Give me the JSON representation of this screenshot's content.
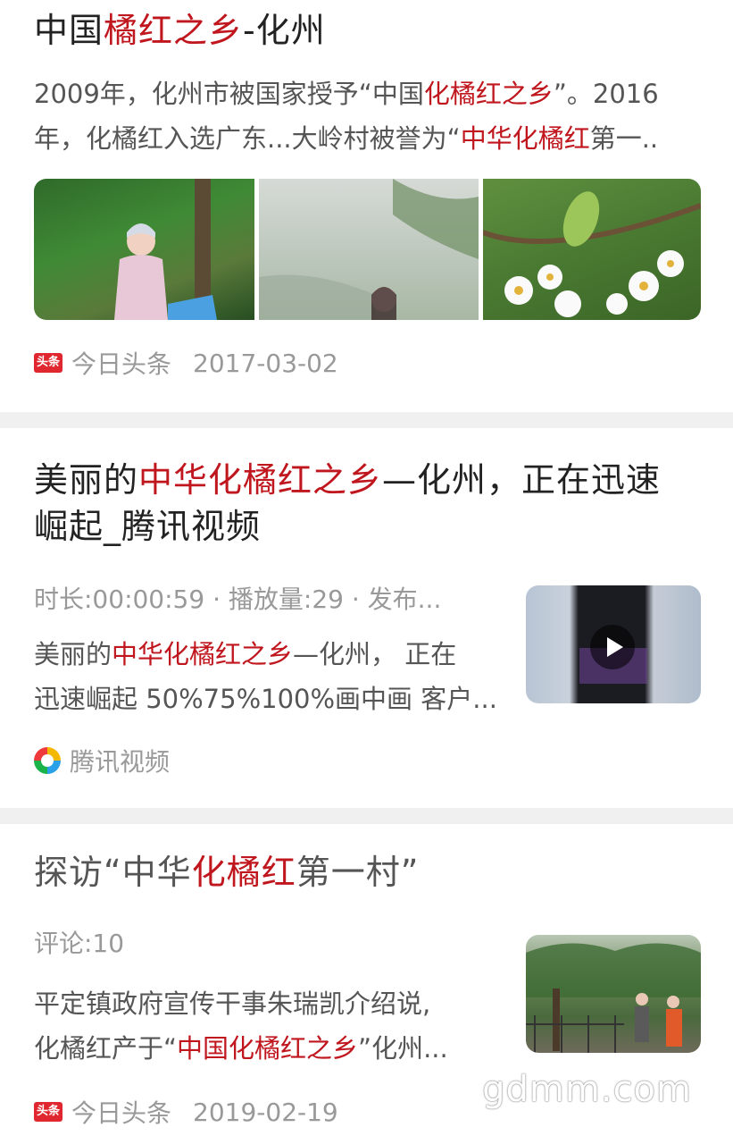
{
  "results": [
    {
      "title_parts": [
        "中国",
        "橘红之乡",
        "-化州"
      ],
      "snippet_line1_parts": [
        "2009年，化州市被国家授予“中国",
        "化橘红之乡",
        "”。2016"
      ],
      "snippet_line2_parts": [
        "年，化橘红入选广东...大岭村被誉为“",
        "中华化橘红",
        "第一.."
      ],
      "source": "今日头条",
      "date": "2017-03-02"
    },
    {
      "title_line1_parts": [
        "美丽的",
        "中华化橘红之乡",
        "—化州，正在迅速"
      ],
      "title_line2": "崛起_腾讯视频",
      "meta": "时长:00:00:59 · 播放量:29 · 发布...",
      "snippet_line1_parts": [
        "美丽的",
        "中华化橘红之乡",
        "—化州， 正在"
      ],
      "snippet_line2": "迅速崛起 50%75%100%画中画 客户...",
      "source": "腾讯视频"
    },
    {
      "title_parts": [
        "探访“中华",
        "化橘红",
        "第一村”"
      ],
      "meta": "评论:10",
      "snippet_line1": "平定镇政府宣传干事朱瑞凯介绍说,",
      "snippet_line2_parts": [
        "化橘红产于“",
        "中国化橘红之乡",
        "”化州..."
      ],
      "source": "今日头条",
      "date": "2019-02-19"
    }
  ],
  "source_logo_text": "头条",
  "watermark": "gdmm.com",
  "colors": {
    "highlight": "#c0161e",
    "title": "#222222",
    "meta": "#999999"
  },
  "icons": [
    "toutiao-logo-icon",
    "tencent-video-logo-icon",
    "play-icon"
  ]
}
